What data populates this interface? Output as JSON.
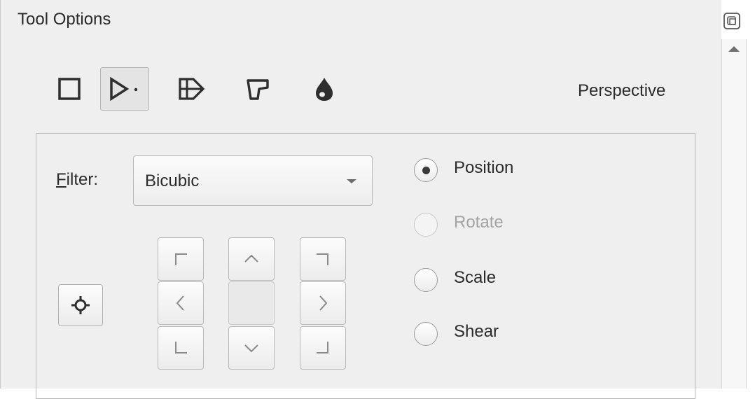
{
  "panel": {
    "title": "Tool Options"
  },
  "transform_modes": {
    "items": [
      {
        "name": "rectangle",
        "icon": "square-icon"
      },
      {
        "name": "perspective",
        "icon": "perspective-icon"
      },
      {
        "name": "warp",
        "icon": "warp-grid-icon"
      },
      {
        "name": "cage",
        "icon": "cage-icon"
      },
      {
        "name": "liquify",
        "icon": "drop-icon"
      }
    ],
    "active": "perspective",
    "active_label": "Perspective"
  },
  "filter": {
    "label_underlined": "F",
    "label_rest": "ilter:",
    "value": "Bicubic"
  },
  "action_modes": [
    {
      "label": "Position",
      "selected": true,
      "enabled": true
    },
    {
      "label": "Rotate",
      "selected": false,
      "enabled": false
    },
    {
      "label": "Scale",
      "selected": false,
      "enabled": true
    },
    {
      "label": "Shear",
      "selected": false,
      "enabled": true
    }
  ],
  "pivot": {
    "buttons": [
      "top-left",
      "top",
      "top-right",
      "left",
      "center",
      "right",
      "bottom-left",
      "bottom",
      "bottom-right"
    ]
  },
  "colors": {
    "panel_bg": "#efefef",
    "text": "#2b2b2b",
    "disabled_text": "#a4a4a4"
  }
}
